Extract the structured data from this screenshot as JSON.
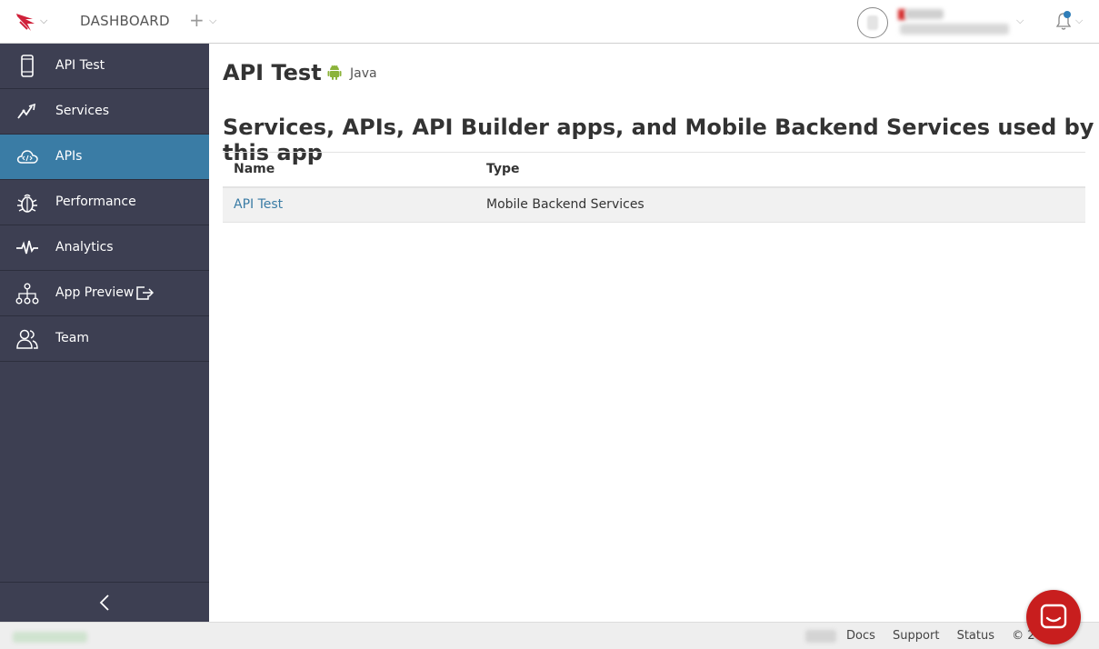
{
  "header": {
    "dashboard_label": "DASHBOARD",
    "brand_color": "#d0213a"
  },
  "sidebar": {
    "items": [
      {
        "label": "API Test",
        "icon": "phone-icon"
      },
      {
        "label": "Services",
        "icon": "services-icon"
      },
      {
        "label": "APIs",
        "icon": "cloud-code-icon",
        "active": true
      },
      {
        "label": "Performance",
        "icon": "bug-icon"
      },
      {
        "label": "Analytics",
        "icon": "pulse-icon"
      },
      {
        "label": "App Preview",
        "icon": "hierarchy-icon",
        "extra_icon": "external-link-icon"
      },
      {
        "label": "Team",
        "icon": "team-icon"
      }
    ],
    "colors": {
      "background": "#3d3f52",
      "active": "#3a7ca5"
    }
  },
  "main": {
    "title": "API Test",
    "platform": "Java",
    "section_title": "Services, APIs, API Builder apps, and Mobile Backend Services used by this app",
    "table": {
      "columns": [
        "Name",
        "Type"
      ],
      "rows": [
        {
          "name": "API Test",
          "type": "Mobile Backend Services"
        }
      ]
    }
  },
  "footer": {
    "links": [
      "Docs",
      "Support",
      "Status"
    ],
    "copyright": "© 2018"
  }
}
